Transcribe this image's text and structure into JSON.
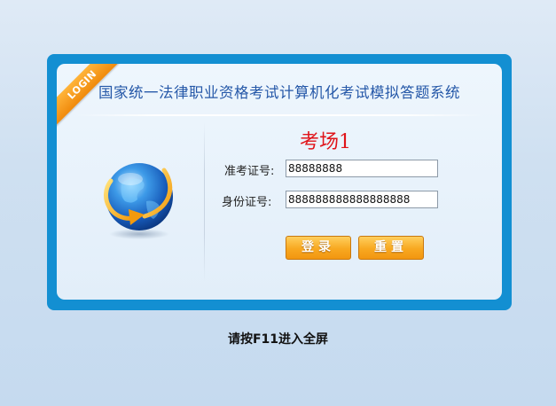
{
  "login_badge": "LOGIN",
  "title": "国家统一法律职业资格考试计算机化考试模拟答题系统",
  "exam_room": "考场1",
  "form": {
    "admission_label": "准考证号:",
    "admission_value": "88888888",
    "id_label": "身份证号:",
    "id_value": "888888888888888888"
  },
  "buttons": {
    "login": "登录",
    "reset": "重置"
  },
  "hint": "请按F11进入全屏",
  "colors": {
    "frame_border": "#138fd2",
    "title_text": "#2558a8",
    "exam_room_text": "#e0141a",
    "button_orange": "#f8a820"
  },
  "icons": {
    "globe": "globe-with-arrow-icon"
  }
}
